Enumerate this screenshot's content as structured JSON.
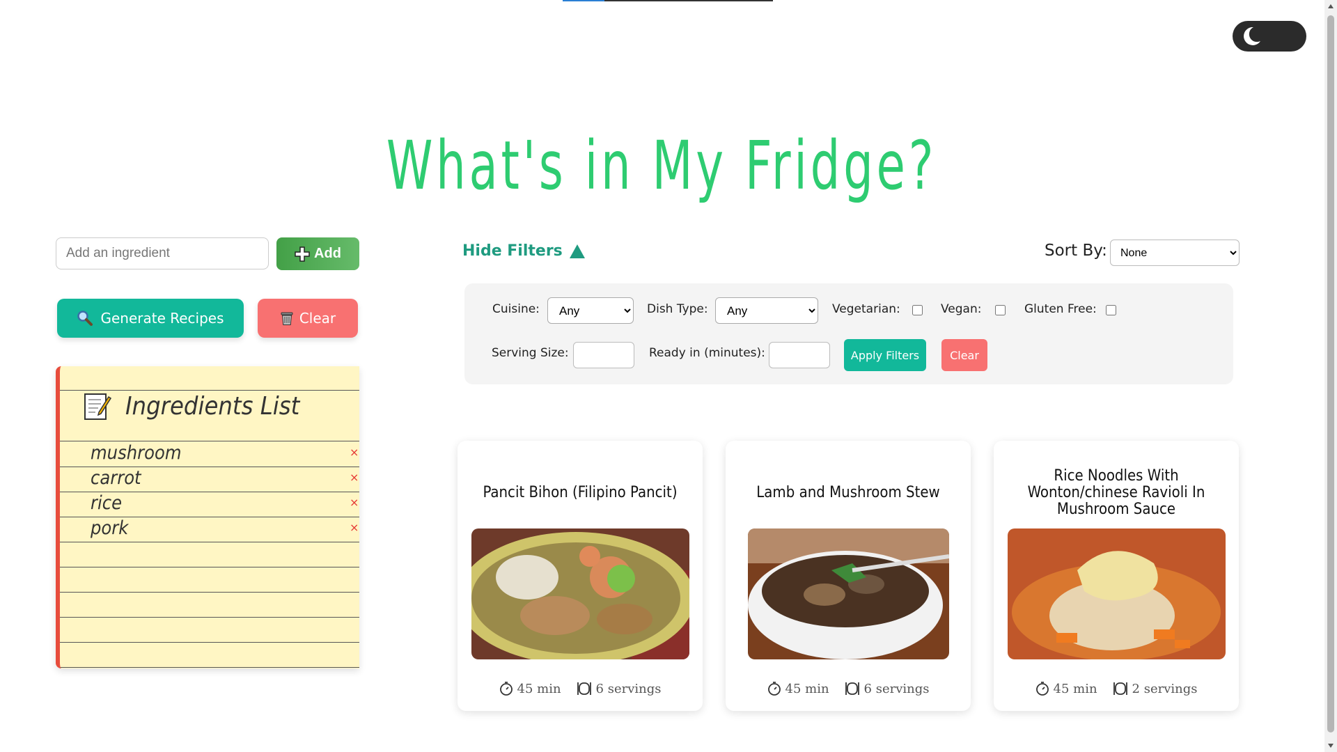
{
  "title": "What's in My Fridge?",
  "theme": {
    "toggle_icon": "moon-icon",
    "toggle_bg": "#2b2b2b"
  },
  "colors": {
    "accent": "#2ecc71",
    "primary": "#12b89a",
    "danger": "#f87171",
    "notepad": "#fff6c4",
    "notepad_margin": "#e74c3c"
  },
  "ingredient_input": {
    "placeholder": "Add an ingredient",
    "value": ""
  },
  "add_button": {
    "label": "Add",
    "icon": "plus-icon"
  },
  "generate_button": {
    "label": "Generate Recipes",
    "icon": "magnifier-icon"
  },
  "clear_button": {
    "label": "Clear",
    "icon": "trash-icon"
  },
  "ingredients_list": {
    "title": "Ingredients List",
    "icon": "memo-icon",
    "items": [
      {
        "name": "mushroom",
        "remove": "×"
      },
      {
        "name": "carrot",
        "remove": "×"
      },
      {
        "name": "rice",
        "remove": "×"
      },
      {
        "name": "pork",
        "remove": "×"
      }
    ]
  },
  "filters": {
    "toggle_label": "Hide Filters",
    "sort_label": "Sort By:",
    "sort_value": "None",
    "cuisine_label": "Cuisine:",
    "cuisine_value": "Any",
    "dish_type_label": "Dish Type:",
    "dish_type_value": "Any",
    "vegetarian_label": "Vegetarian:",
    "vegan_label": "Vegan:",
    "gluten_free_label": "Gluten Free:",
    "serving_size_label": "Serving Size:",
    "ready_in_label": "Ready in (minutes):",
    "apply_label": "Apply Filters",
    "clear_label": "Clear"
  },
  "recipes": [
    {
      "title": "Pancit Bihon (Filipino Pancit)",
      "time": "45 min",
      "servings": "6 servings"
    },
    {
      "title": "Lamb and Mushroom Stew",
      "time": "45 min",
      "servings": "6 servings"
    },
    {
      "title": "Rice Noodles With Wonton/chinese Ravioli In Mushroom Sauce",
      "time": "45 min",
      "servings": "2 servings"
    }
  ]
}
